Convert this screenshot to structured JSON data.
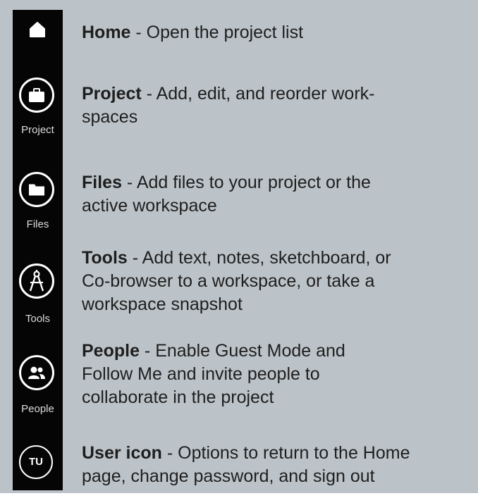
{
  "sidebar": {
    "items": [
      {
        "icon": "home-icon",
        "label": ""
      },
      {
        "icon": "briefcase-icon",
        "label": "Project"
      },
      {
        "icon": "folder-icon",
        "label": "Files"
      },
      {
        "icon": "compass-icon",
        "label": "Tools"
      },
      {
        "icon": "people-icon",
        "label": "People"
      },
      {
        "icon": "user-avatar",
        "label": "",
        "initials": "TU"
      }
    ]
  },
  "descriptions": [
    {
      "title": "Home",
      "text": " - Open the project list"
    },
    {
      "title": "Project",
      "text": " - Add, edit, and reorder work-spaces",
      "lines": [
        "Project - Add, edit, and reorder work-",
        "spaces"
      ]
    },
    {
      "title": "Files",
      "text": " - Add files to your project or the active workspace"
    },
    {
      "title": "Tools",
      "text": " - Add text, notes, sketchboard, or Co-browser to a workspace, or take a workspace snapshot"
    },
    {
      "title": "People",
      "text": " - Enable Guest Mode and Follow Me and invite people to collaborate in the project"
    },
    {
      "title": "User icon",
      "text": " - Options to return to the Home page, change password, and sign out"
    }
  ],
  "desc_text": {
    "home": " - Open the project list",
    "project_line1": " - Add, edit, and reorder work-",
    "project_line2": "spaces",
    "files_line1": " - Add files to your project or the",
    "files_line2": "active workspace",
    "tools_line1": " - Add text, notes, sketchboard, or",
    "tools_line2": "Co-browser to a workspace, or take a",
    "tools_line3": "workspace snapshot",
    "people_line1": " - Enable Guest Mode and",
    "people_line2": "Follow Me and invite people to",
    "people_line3": "collaborate in the project",
    "user_line1": " - Options to return to the Home",
    "user_line2": "page, change password, and sign out"
  },
  "colors": {
    "sidebar_bg": "#050505",
    "panel_bg": "#bcc3c8",
    "text": "#1e1e1e",
    "icon": "#ffffff"
  }
}
